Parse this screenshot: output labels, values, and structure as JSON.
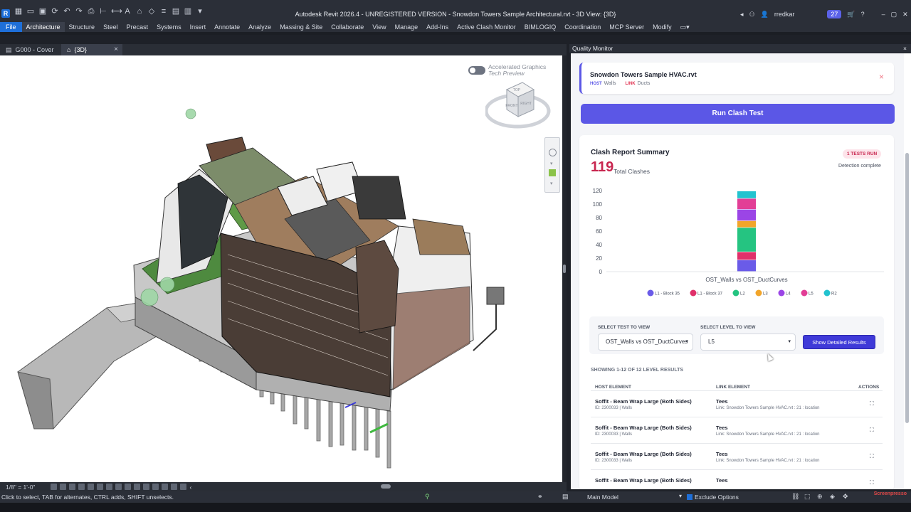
{
  "app": {
    "logo": "R",
    "title": "Autodesk Revit 2026.4 - UNREGISTERED VERSION - Snowdon Towers Sample Architectural.rvt - 3D View: {3D}",
    "user": "rredkar",
    "notifications": "27"
  },
  "ribbon": {
    "tabs": [
      "File",
      "Architecture",
      "Structure",
      "Steel",
      "Precast",
      "Systems",
      "Insert",
      "Annotate",
      "Analyze",
      "Massing & Site",
      "Collaborate",
      "View",
      "Manage",
      "Add-Ins",
      "Active Clash Monitor",
      "BIMLOGIQ",
      "Coordination",
      "MCP Server",
      "Modify"
    ],
    "active": "Architecture"
  },
  "view_tabs": [
    {
      "label": "G000 - Cover",
      "icon": "sheet-icon"
    },
    {
      "label": "{3D}",
      "icon": "house-icon",
      "close": "×"
    }
  ],
  "viewport": {
    "accel_line1": "Accelerated Graphics",
    "accel_line2": "Tech Preview",
    "viewcube_top": "TOP",
    "viewcube_front": "FRONT",
    "viewcube_right": "RIGHT"
  },
  "view_control": {
    "scale": "1/8\" = 1'-0\""
  },
  "statusbar": {
    "hint": "Click to select, TAB for alternates, CTRL adds, SHIFT unselects.",
    "model": "Main Model",
    "exclude": "Exclude Options",
    "brand": "Screenpresso"
  },
  "panel": {
    "title": "Quality Monitor",
    "close": "×",
    "file": {
      "name": "Snowdon Towers Sample HVAC.rvt",
      "host_tag": "HOST",
      "host_value": "Walls",
      "link_tag": "LINK",
      "link_value": "Ducts",
      "close": "×"
    },
    "run_button": "Run Clash Test",
    "summary": {
      "title": "Clash Report Summary",
      "total": "119",
      "total_label": "Total Clashes",
      "badge": "1 TESTS RUN",
      "status": "Detection complete"
    },
    "filters": {
      "test_label": "SELECT TEST TO VIEW",
      "test_value": "OST_Walls vs OST_DuctCurves",
      "level_label": "SELECT LEVEL TO VIEW",
      "level_value": "L5",
      "show_button": "Show Detailed Results"
    },
    "results_label": "SHOWING 1-12 OF 12 LEVEL RESULTS",
    "table": {
      "headers": {
        "host": "HOST ELEMENT",
        "link": "LINK ELEMENT",
        "actions": "ACTIONS"
      },
      "rows": [
        {
          "host": "Soffit - Beam Wrap Large (Both Sides)",
          "host_sub": "ID: 2300033 | Walls",
          "link": "Tees",
          "link_sub": "Link: Snowdon Towers Sample HVAC.rvt : 21 : location"
        },
        {
          "host": "Soffit - Beam Wrap Large (Both Sides)",
          "host_sub": "ID: 2300033 | Walls",
          "link": "Tees",
          "link_sub": "Link: Snowdon Towers Sample HVAC.rvt : 21 : location"
        },
        {
          "host": "Soffit - Beam Wrap Large (Both Sides)",
          "host_sub": "ID: 2300033 | Walls",
          "link": "Tees",
          "link_sub": "Link: Snowdon Towers Sample HVAC.rvt : 21 : location"
        },
        {
          "host": "Soffit - Beam Wrap Large (Both Sides)",
          "host_sub": "",
          "link": "Tees",
          "link_sub": ""
        }
      ]
    }
  },
  "chart_data": {
    "type": "bar",
    "stacked": true,
    "categories": [
      "OST_Walls vs OST_DuctCurves"
    ],
    "ylim": [
      0,
      120
    ],
    "yticks": [
      "0",
      "20",
      "40",
      "60",
      "80",
      "100",
      "120"
    ],
    "series": [
      {
        "name": "L1 - Block 35",
        "values": [
          17
        ],
        "color": "#6a5be8"
      },
      {
        "name": "L1 - Block 37",
        "values": [
          12
        ],
        "color": "#e0306a"
      },
      {
        "name": "L2",
        "values": [
          36
        ],
        "color": "#25c481"
      },
      {
        "name": "L3",
        "values": [
          10
        ],
        "color": "#f2a52a"
      },
      {
        "name": "L4",
        "values": [
          17
        ],
        "color": "#9b45e6"
      },
      {
        "name": "L5",
        "values": [
          16
        ],
        "color": "#e23e96"
      },
      {
        "name": "R2",
        "values": [
          11
        ],
        "color": "#22c3cf"
      }
    ],
    "legend_placement": "bottom",
    "grid": false
  }
}
